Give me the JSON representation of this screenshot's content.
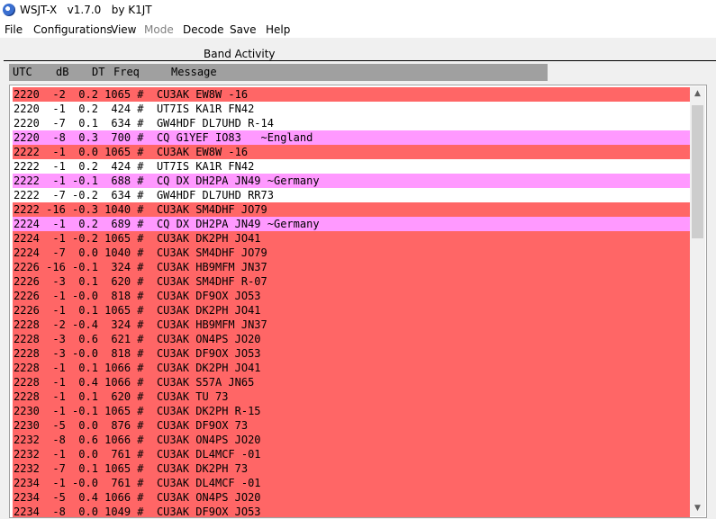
{
  "window": {
    "title": "WSJT-X   v1.7.0   by K1JT"
  },
  "menu": [
    {
      "label": "File",
      "enabled": true
    },
    {
      "label": "Configurations",
      "enabled": true
    },
    {
      "label": "View",
      "enabled": true
    },
    {
      "label": "Mode",
      "enabled": false
    },
    {
      "label": "Decode",
      "enabled": true
    },
    {
      "label": "Save",
      "enabled": true
    },
    {
      "label": "Help",
      "enabled": true
    }
  ],
  "band_activity": {
    "label": "Band Activity",
    "columns": [
      "UTC",
      "dB",
      "DT",
      "Freq",
      "Message"
    ],
    "colors": {
      "cq": "#ff99ff",
      "to_me": "#ff6666",
      "normal": "#ffffff",
      "header": "#a0a0a0"
    },
    "rows": [
      {
        "text": "2220  -2  0.2 1065 #  CU3AK EW8W -16",
        "type": "to_me"
      },
      {
        "text": "2220  -1  0.2  424 #  UT7IS KA1R FN42",
        "type": "normal"
      },
      {
        "text": "2220  -7  0.1  634 #  GW4HDF DL7UHD R-14",
        "type": "normal"
      },
      {
        "text": "2220  -8  0.3  700 #  CQ G1YEF IO83   ~England",
        "type": "cq"
      },
      {
        "text": "2222  -1  0.0 1065 #  CU3AK EW8W -16",
        "type": "to_me"
      },
      {
        "text": "2222  -1  0.2  424 #  UT7IS KA1R FN42",
        "type": "normal"
      },
      {
        "text": "2222  -1 -0.1  688 #  CQ DX DH2PA JN49 ~Germany",
        "type": "cq"
      },
      {
        "text": "2222  -7 -0.2  634 #  GW4HDF DL7UHD RR73",
        "type": "normal"
      },
      {
        "text": "2222 -16 -0.3 1040 #  CU3AK SM4DHF JO79",
        "type": "to_me"
      },
      {
        "text": "2224  -1  0.2  689 #  CQ DX DH2PA JN49 ~Germany",
        "type": "cq"
      },
      {
        "text": "2224  -1 -0.2 1065 #  CU3AK DK2PH JO41",
        "type": "to_me"
      },
      {
        "text": "2224  -7  0.0 1040 #  CU3AK SM4DHF JO79",
        "type": "to_me"
      },
      {
        "text": "2226 -16 -0.1  324 #  CU3AK HB9MFM JN37",
        "type": "to_me"
      },
      {
        "text": "2226  -3  0.1  620 #  CU3AK SM4DHF R-07",
        "type": "to_me"
      },
      {
        "text": "2226  -1 -0.0  818 #  CU3AK DF9OX JO53",
        "type": "to_me"
      },
      {
        "text": "2226  -1  0.1 1065 #  CU3AK DK2PH JO41",
        "type": "to_me"
      },
      {
        "text": "2228  -2 -0.4  324 #  CU3AK HB9MFM JN37",
        "type": "to_me"
      },
      {
        "text": "2228  -3  0.6  621 #  CU3AK ON4PS JO20",
        "type": "to_me"
      },
      {
        "text": "2228  -3 -0.0  818 #  CU3AK DF9OX JO53",
        "type": "to_me"
      },
      {
        "text": "2228  -1  0.1 1066 #  CU3AK DK2PH JO41",
        "type": "to_me"
      },
      {
        "text": "2228  -1  0.4 1066 #  CU3AK S57A JN65",
        "type": "to_me"
      },
      {
        "text": "2228  -1  0.1  620 #  CU3AK TU 73",
        "type": "to_me"
      },
      {
        "text": "2230  -1 -0.1 1065 #  CU3AK DK2PH R-15",
        "type": "to_me"
      },
      {
        "text": "2230  -5  0.0  876 #  CU3AK DF9OX 73",
        "type": "to_me"
      },
      {
        "text": "2232  -8  0.6 1066 #  CU3AK ON4PS JO20",
        "type": "to_me"
      },
      {
        "text": "2232  -1  0.0  761 #  CU3AK DL4MCF -01",
        "type": "to_me"
      },
      {
        "text": "2232  -7  0.1 1065 #  CU3AK DK2PH 73",
        "type": "to_me"
      },
      {
        "text": "2234  -1 -0.0  761 #  CU3AK DL4MCF -01",
        "type": "to_me"
      },
      {
        "text": "2234  -5  0.4 1066 #  CU3AK ON4PS JO20",
        "type": "to_me"
      },
      {
        "text": "2234  -8  0.0 1049 #  CU3AK DF9OX JO53",
        "type": "to_me"
      }
    ]
  },
  "icons": {
    "app": "wsjtx-app-icon",
    "scroll_up": "chevron-up-icon",
    "scroll_down": "chevron-down-icon"
  }
}
